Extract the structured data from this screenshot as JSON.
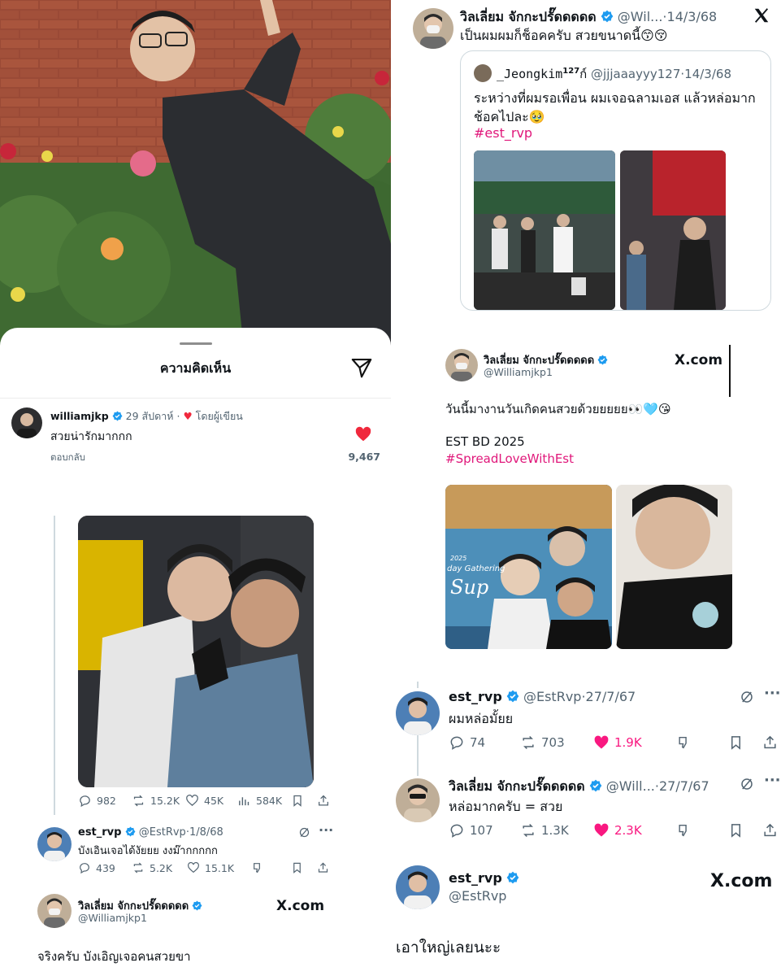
{
  "left_sheet": {
    "title": "ความคิดเห็น",
    "comment": {
      "username": "williamjkp",
      "time": "29 สัปดาห์",
      "liked_by_author": "โดยผู้เขียน",
      "text": "สวยน่ารักมากกก",
      "reply": "ตอบกลับ",
      "likes": "9,467"
    }
  },
  "left_tweet": {
    "stats": {
      "replies": "982",
      "reposts": "15.2K",
      "likes": "45K",
      "views": "584K"
    },
    "reply": {
      "name": "est_rvp",
      "handle": "@EstRvp",
      "date": "1/8/68",
      "text": "บังเอินเจอได้งัยยย งงม๊ากกกกก",
      "stats": {
        "replies": "439",
        "reposts": "5.2K",
        "likes": "15.1K"
      }
    },
    "card": {
      "name": "วิลเลี่ยม จักกะปรั๊ดดดดด",
      "handle": "@Williamjkp1",
      "brand": "X.com",
      "text": "จริงครับ บังเอิญเจอคนสวยขา"
    }
  },
  "right_top": {
    "name": "วิลเลี่ยม จักกะปรั๊ดดดดด",
    "handle": "@Wil...",
    "date": "14/3/68",
    "text": "เป็นผมผมก็ช็อคครับ สวยขนาดนี้😙😚",
    "quote": {
      "name": "_Jeongkim",
      "name_sup": "127",
      "name_suffix": "ก์",
      "handle": "@jjjaaayyy127",
      "date": "14/3/68",
      "text": "ระหว่างที่ผมรอเพื่อน ผมเจอฉลามเอส แล้วหล่อมาก ช้อคไปละ🥹",
      "hashtag": "#est_rvp"
    }
  },
  "right_card": {
    "name": "วิลเลี่ยม จักกะปรั๊ดดดดด",
    "handle": "@Williamjkp1",
    "brand": "X.com",
    "line1": "วันนี้มางานวันเกิดคนสวยด้วยยยยย👀🩵😘",
    "line2": "EST BD 2025",
    "hashtag": "#SpreadLoveWithEst",
    "poster_text": "2025",
    "poster_subtitle": "day Gathering",
    "poster_title": "Sup"
  },
  "right_thread": {
    "t1": {
      "name": "est_rvp",
      "handle": "@EstRvp",
      "date": "27/7/67",
      "text": "ผมหล่อมั้ยย",
      "stats": {
        "replies": "74",
        "reposts": "703",
        "likes": "1.9K"
      }
    },
    "t2": {
      "name": "วิลเลี่ยม จักกะปรั๊ดดดดด",
      "handle": "@Will...",
      "date": "27/7/67",
      "text": "หล่อมากครับ = สวย",
      "stats": {
        "replies": "107",
        "reposts": "1.3K",
        "likes": "2.3K"
      }
    }
  },
  "right_bottom": {
    "name": "est_rvp",
    "handle": "@EstRvp",
    "brand": "X.com",
    "text": "เอาใหญ่เลยนะะ"
  },
  "colors": {
    "accent": "#1d9bf0",
    "like": "#f91880",
    "hashtag": "#e0177a",
    "heart": "#f0283c"
  },
  "icons": [
    "verified-icon",
    "send-icon",
    "x-logo-icon",
    "reply-icon",
    "repost-icon",
    "like-icon",
    "views-icon",
    "bookmark-icon",
    "share-icon",
    "grok-icon",
    "more-icon",
    "dislike-icon"
  ]
}
